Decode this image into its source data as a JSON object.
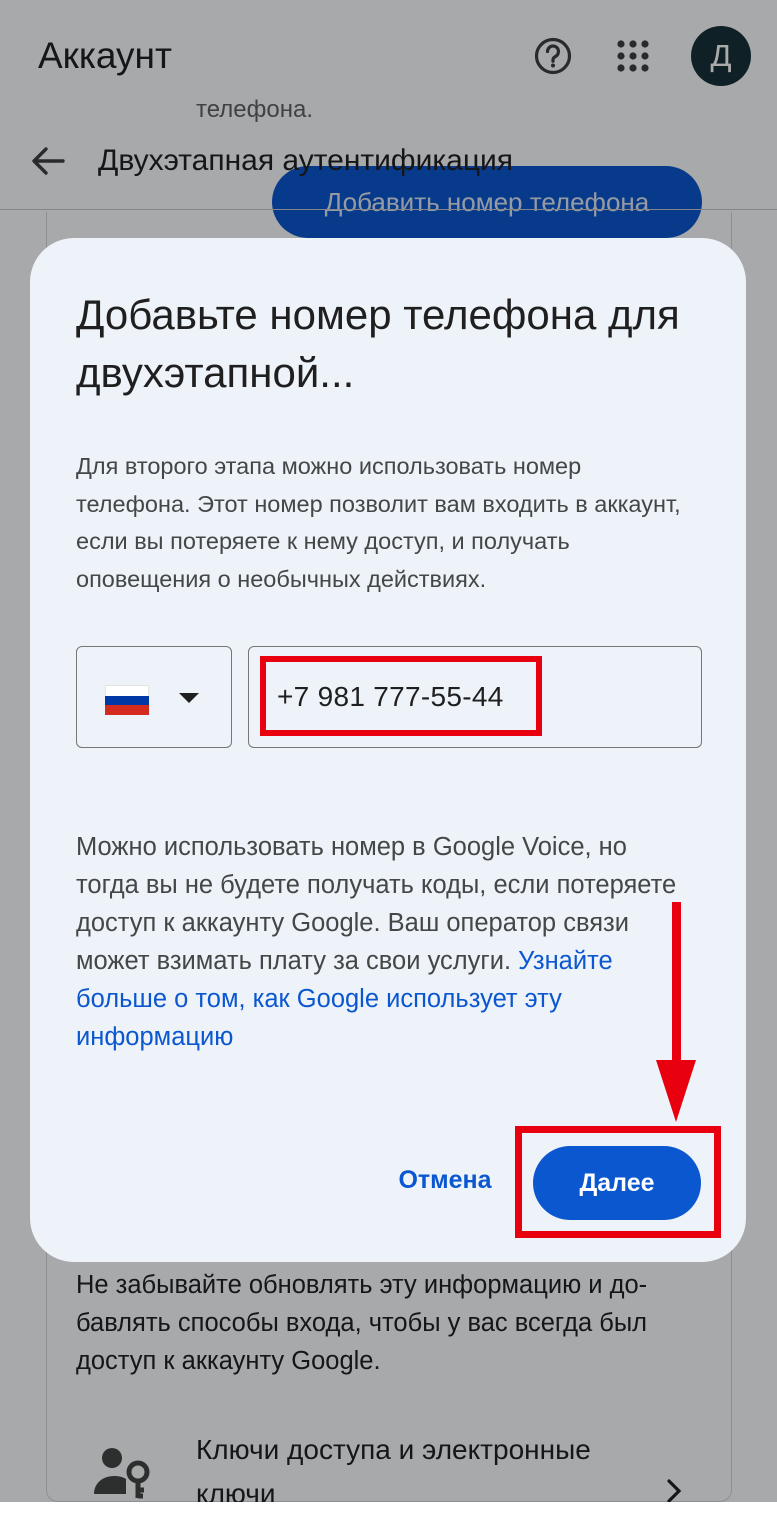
{
  "appbar": {
    "title": "Аккаунт",
    "help_icon": "help-circle-icon",
    "apps_icon": "apps-grid-icon",
    "avatar_letter": "Д"
  },
  "background": {
    "ghost_text": "телефона.",
    "subbar_title": "Двухэтапная аутентификация",
    "ghost_button_label": "Добавить номер телефона",
    "note": "Не забывайте обновлять эту информацию и до-бавлять способы входа, чтобы у вас всегда был доступ к аккаунту Google.",
    "row_title": "Ключи доступа и электронные ключи",
    "row_icon": "person-key-icon",
    "row_chevron": "chevron-right-icon"
  },
  "dialog": {
    "title": "Добавьте номер телефона для двухэтапной...",
    "description": "Для второго этапа можно использовать номер телефона. Этот номер позволит вам входить в аккаунт, если вы потеряете к нему доступ, и получать оповещения о необычных действиях.",
    "country_flag": "russia-flag-icon",
    "phone_value": "+7 981 777-55-44",
    "note_text": "Можно использовать номер в Google Voice, но тогда вы не будете получать коды, если потеряете доступ к аккаунту Google. Ваш оператор связи может взимать плату за свои услуги. ",
    "note_link": "Узнайте больше о том, как Google использует эту информацию",
    "cancel_label": "Отмена",
    "next_label": "Далее"
  },
  "colors": {
    "accent": "#0b57d0",
    "highlight": "#e8000e",
    "dialog_bg": "#eef2f9"
  }
}
